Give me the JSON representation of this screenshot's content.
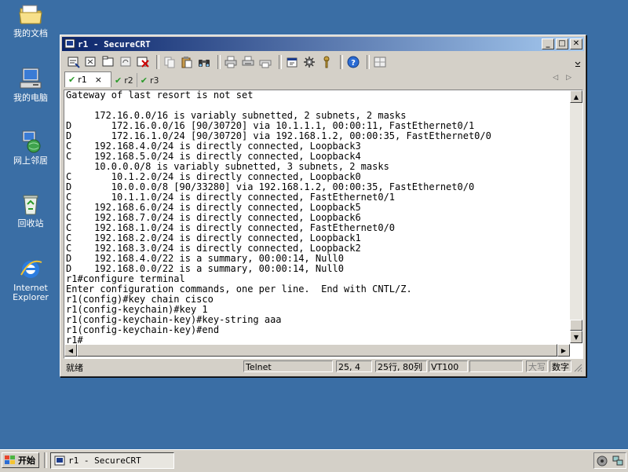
{
  "desktop": {
    "icons": [
      {
        "label": "我的文档"
      },
      {
        "label": "我的电脑"
      },
      {
        "label": "网上邻居"
      },
      {
        "label": "回收站"
      },
      {
        "label_line1": "Internet",
        "label_line2": "Explorer"
      }
    ]
  },
  "window": {
    "title": "r1 - SecureCRT",
    "tabs": [
      {
        "label": "r1",
        "close": "×"
      },
      {
        "label": "r2"
      },
      {
        "label": "r3"
      }
    ],
    "terminal_lines": [
      "Gateway of last resort is not set",
      "",
      "     172.16.0.0/16 is variably subnetted, 2 subnets, 2 masks",
      "D       172.16.0.0/16 [90/30720] via 10.1.1.1, 00:00:11, FastEthernet0/1",
      "D       172.16.1.0/24 [90/30720] via 192.168.1.2, 00:00:35, FastEthernet0/0",
      "C    192.168.4.0/24 is directly connected, Loopback3",
      "C    192.168.5.0/24 is directly connected, Loopback4",
      "     10.0.0.0/8 is variably subnetted, 3 subnets, 2 masks",
      "C       10.1.2.0/24 is directly connected, Loopback0",
      "D       10.0.0.0/8 [90/33280] via 192.168.1.2, 00:00:35, FastEthernet0/0",
      "C       10.1.1.0/24 is directly connected, FastEthernet0/1",
      "C    192.168.6.0/24 is directly connected, Loopback5",
      "C    192.168.7.0/24 is directly connected, Loopback6",
      "C    192.168.1.0/24 is directly connected, FastEthernet0/0",
      "C    192.168.2.0/24 is directly connected, Loopback1",
      "C    192.168.3.0/24 is directly connected, Loopback2",
      "D    192.168.4.0/22 is a summary, 00:00:14, Null0",
      "D    192.168.0.0/22 is a summary, 00:00:14, Null0",
      "r1#configure terminal",
      "Enter configuration commands, one per line.  End with CNTL/Z.",
      "r1(config)#key chain cisco",
      "r1(config-keychain)#key 1",
      "r1(config-keychain-key)#key-string aaa",
      "r1(config-keychain-key)#end",
      "r1#"
    ],
    "status": {
      "ready": "就绪",
      "protocol": "Telnet",
      "cursor": "25,  4",
      "size": "25行, 80列",
      "emulation": "VT100",
      "caps": "大写",
      "num": "数字"
    }
  },
  "taskbar": {
    "start_label": "开始",
    "task_label": "r1 - SecureCRT"
  }
}
